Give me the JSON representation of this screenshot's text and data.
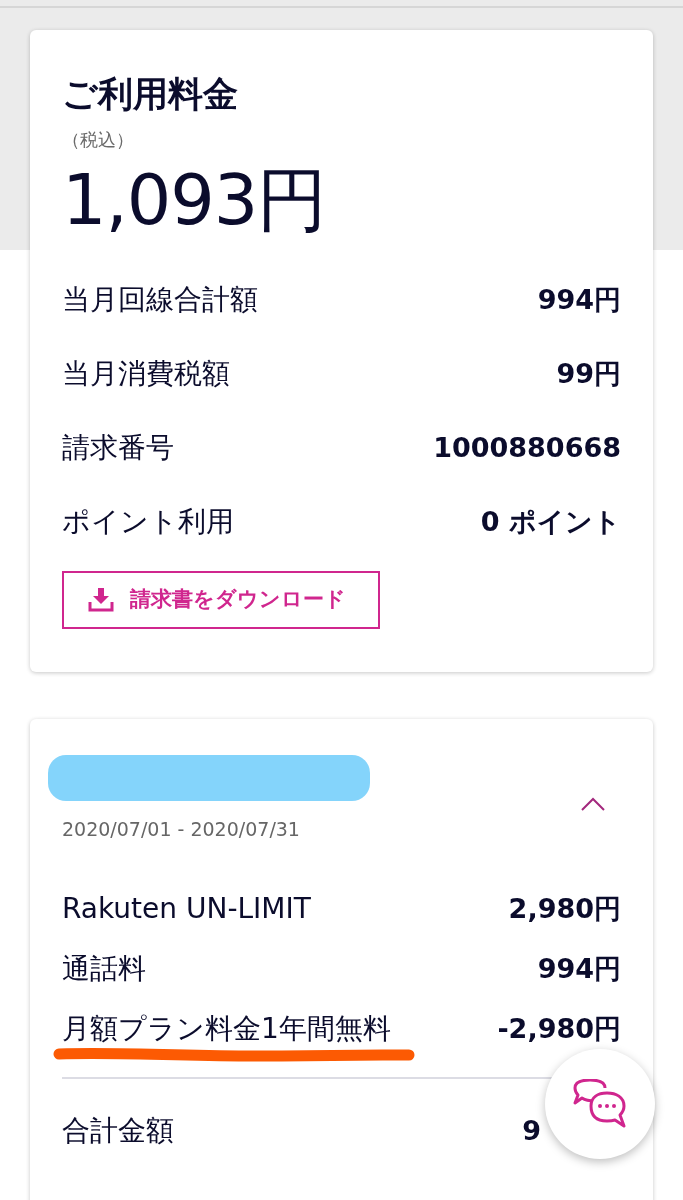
{
  "summary_card": {
    "title": "ご利用料金",
    "tax_note": "（税込）",
    "amount": "1,093円",
    "rows": [
      {
        "label": "当月回線合計額",
        "value": "994円"
      },
      {
        "label": "当月消費税額",
        "value": "99円"
      },
      {
        "label": "請求番号",
        "value": "1000880668"
      },
      {
        "label": "ポイント利用",
        "value": "0 ポイント"
      }
    ],
    "download_button": {
      "label": "請求書をダウンロード"
    }
  },
  "plan_card": {
    "title_redacted": true,
    "period": "2020/07/01 - 2020/07/31",
    "expanded": true,
    "items": [
      {
        "label": "Rakuten UN-LIMIT",
        "value": "2,980円",
        "underlined": false
      },
      {
        "label": "通話料",
        "value": "994円",
        "underlined": false
      },
      {
        "label": "月額プラン料金1年間無料",
        "value": "-2,980円",
        "underlined": true
      }
    ],
    "total": {
      "label": "合計金額",
      "value": "9"
    }
  }
}
